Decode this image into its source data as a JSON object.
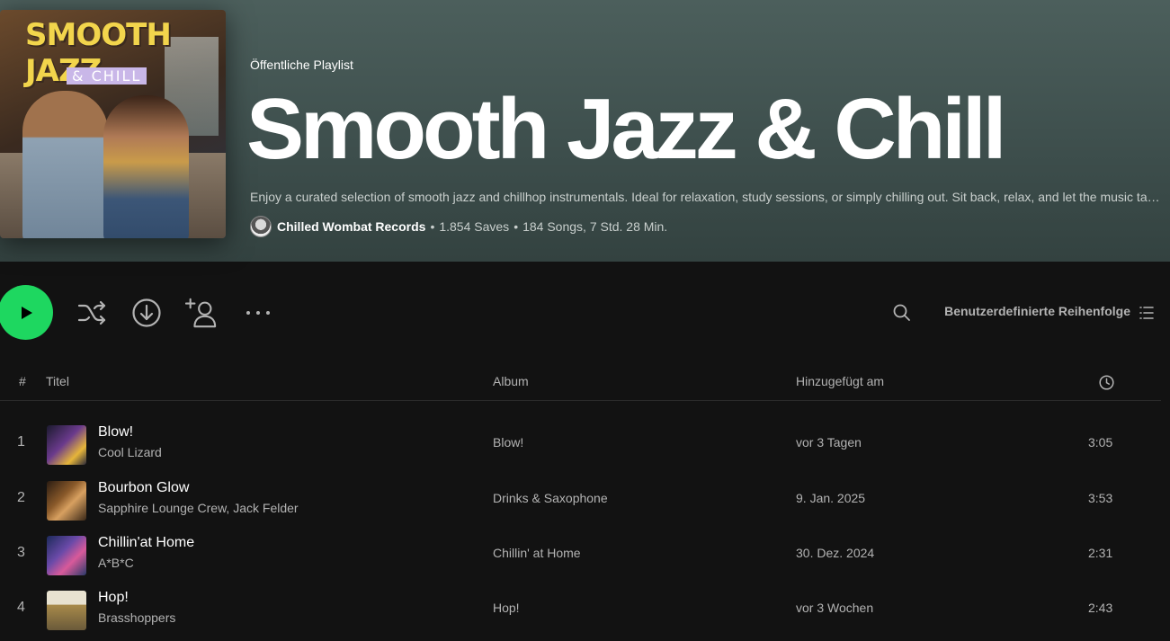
{
  "playlist": {
    "cover_title": "SMOOTH JAZZ",
    "cover_subtitle": "& CHILL",
    "kind": "Öffentliche Playlist",
    "title": "Smooth Jazz & Chill",
    "description": "Enjoy a curated selection of smooth jazz and chillhop instrumentals. Ideal for relaxation, study sessions, or simply chilling out. Sit back, relax, and let the music take you away.",
    "owner": "Chilled Wombat Records",
    "saves": "1.854 Saves",
    "stats": "184 Songs, 7 Std. 28 Min."
  },
  "controls": {
    "sort_label": "Benutzerdefinierte Reihenfolge"
  },
  "columns": {
    "number": "#",
    "title": "Titel",
    "album": "Album",
    "added": "Hinzugefügt am"
  },
  "tracks": [
    {
      "num": "1",
      "title": "Blow!",
      "artist": "Cool Lizard",
      "album": "Blow!",
      "added": "vor 3 Tagen",
      "duration": "3:05"
    },
    {
      "num": "2",
      "title": "Bourbon Glow",
      "artist": "Sapphire Lounge Crew, Jack Felder",
      "album": "Drinks & Saxophone",
      "added": "9. Jan. 2025",
      "duration": "3:53"
    },
    {
      "num": "3",
      "title": "Chillin'at Home",
      "artist": "A*B*C",
      "album": "Chillin' at Home",
      "added": "30. Dez. 2024",
      "duration": "2:31"
    },
    {
      "num": "4",
      "title": "Hop!",
      "artist": "Brasshoppers",
      "album": "Hop!",
      "added": "vor 3 Wochen",
      "duration": "2:43"
    }
  ],
  "colors": {
    "accent": "#1ed760",
    "background": "#121212",
    "header": "#4c5f5c"
  }
}
